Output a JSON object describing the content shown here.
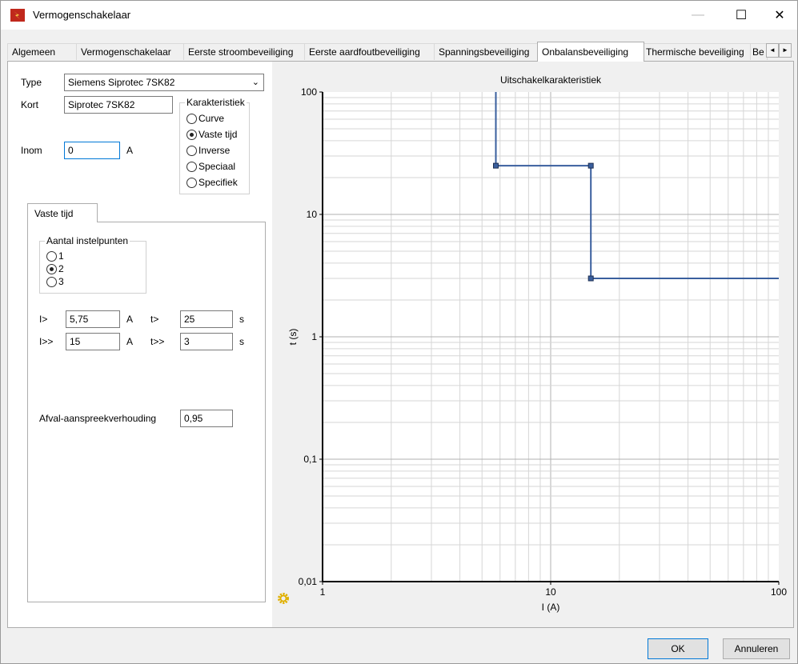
{
  "window": {
    "title": "Vermogenschakelaar",
    "minimize_glyph": "—",
    "maximize_glyph": "☐",
    "close_glyph": "✕"
  },
  "tabs": [
    {
      "label": "Algemeen"
    },
    {
      "label": "Vermogenschakelaar"
    },
    {
      "label": "Eerste stroombeveiliging"
    },
    {
      "label": "Eerste aardfoutbeveiliging"
    },
    {
      "label": "Spanningsbeveiliging"
    },
    {
      "label": "Onbalansbeveiliging"
    },
    {
      "label": "Thermische beveiliging"
    },
    {
      "label": "Be"
    }
  ],
  "active_tab": "Onbalansbeveiliging",
  "tab_scroll": {
    "left": "◄",
    "right": "►"
  },
  "form": {
    "type_label": "Type",
    "type_value": "Siemens Siprotec 7SK82",
    "kort_label": "Kort",
    "kort_value": "Siprotec 7SK82",
    "inom_label": "Inom",
    "inom_value": "0",
    "inom_unit": "A",
    "karakteristiek": {
      "title": "Karakteristiek",
      "options": [
        {
          "label": "Curve",
          "selected": false
        },
        {
          "label": "Vaste tijd",
          "selected": true
        },
        {
          "label": "Inverse",
          "selected": false
        },
        {
          "label": "Speciaal",
          "selected": false
        },
        {
          "label": "Specifiek",
          "selected": false
        }
      ]
    },
    "subtab_label": "Vaste tijd",
    "instelpunten": {
      "title": "Aantal instelpunten",
      "options": [
        {
          "label": "1",
          "selected": false
        },
        {
          "label": "2",
          "selected": true
        },
        {
          "label": "3",
          "selected": false
        }
      ]
    },
    "settings": [
      {
        "i_label": "I>",
        "i_value": "5,75",
        "i_unit": "A",
        "t_label": "t>",
        "t_value": "25",
        "t_unit": "s"
      },
      {
        "i_label": "I>>",
        "i_value": "15",
        "i_unit": "A",
        "t_label": "t>>",
        "t_value": "3",
        "t_unit": "s"
      }
    ],
    "afval_label": "Afval-aanspreekverhouding",
    "afval_value": "0,95"
  },
  "buttons": {
    "ok": "OK",
    "cancel": "Annuleren"
  },
  "chart_data": {
    "type": "line",
    "title": "Uitschakelkarakteristiek",
    "xlabel": "I (A)",
    "ylabel": "t (s)",
    "xscale": "log",
    "yscale": "log",
    "xlim": [
      1,
      100
    ],
    "ylim": [
      0.01,
      100
    ],
    "x_tick_labels": [
      "1",
      "10",
      "100"
    ],
    "y_tick_labels": [
      "0,01",
      "0,1",
      "1",
      "10",
      "100"
    ],
    "grid": true,
    "line_color": "#3a5f9e",
    "series": [
      {
        "points": [
          [
            5.75,
            100
          ],
          [
            5.75,
            25
          ],
          [
            15,
            25
          ],
          [
            15,
            3
          ],
          [
            100,
            3
          ]
        ],
        "markers": [
          [
            5.75,
            25
          ],
          [
            15,
            25
          ],
          [
            15,
            3
          ]
        ]
      }
    ]
  }
}
